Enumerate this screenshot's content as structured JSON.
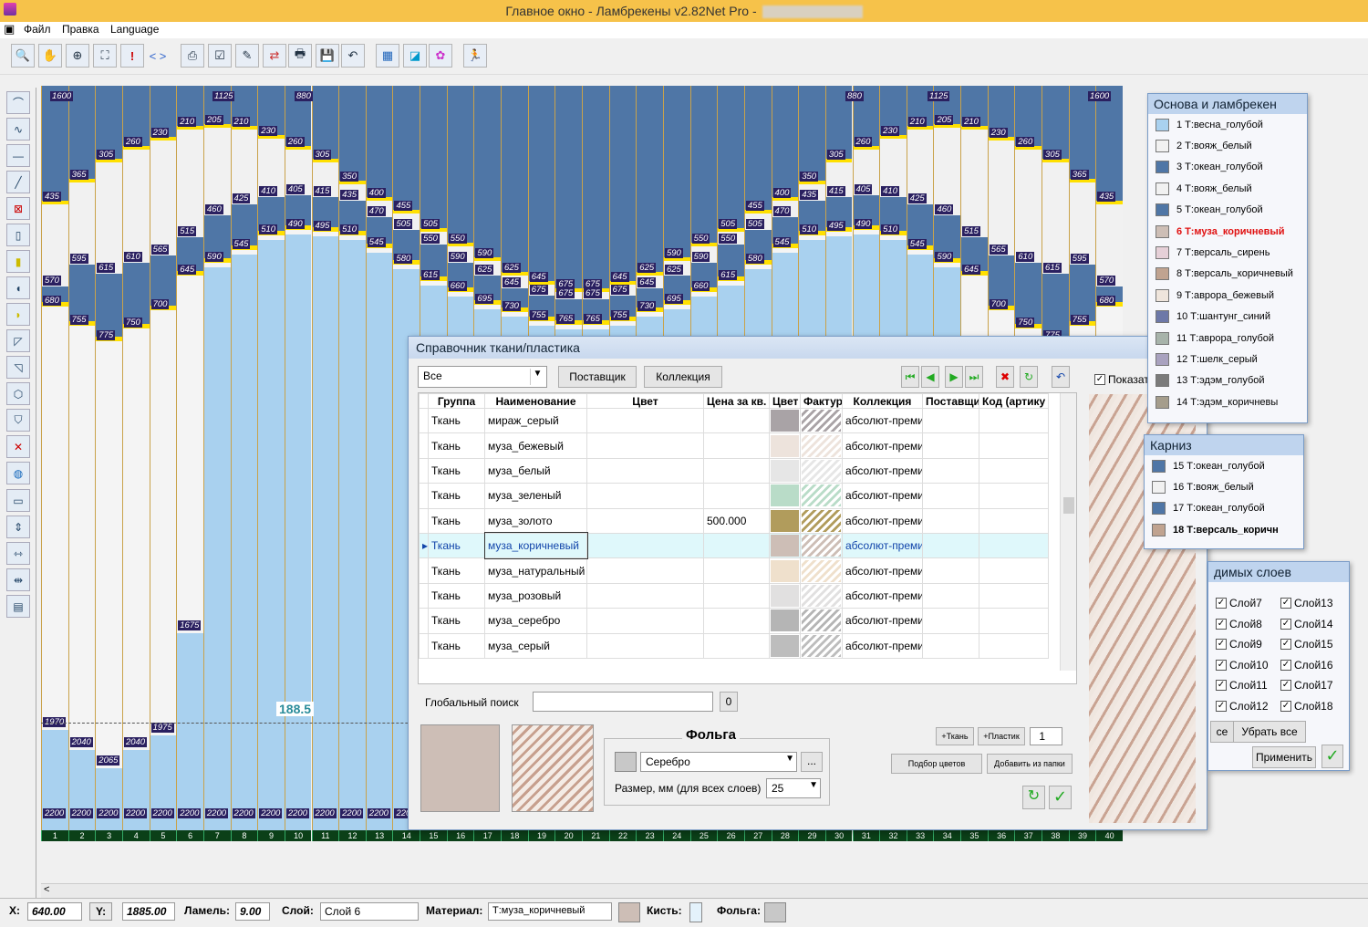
{
  "window": {
    "title": "Главное окно - Ламбрекены v2.82Net Pro  -"
  },
  "menu": [
    "Файл",
    "Правка",
    "Language"
  ],
  "canvas": {
    "top_labels": [
      "1600",
      "1125",
      "880",
      "880",
      "1125",
      "1600"
    ],
    "measure_label": "188.5",
    "bottom_value": "2200",
    "slat_numbers": [
      "1",
      "2",
      "3",
      "4",
      "5",
      "6",
      "7",
      "8",
      "9",
      "10",
      "11",
      "12",
      "13",
      "14",
      "15",
      "16",
      "17",
      "18",
      "19",
      "20",
      "21",
      "22",
      "23",
      "24",
      "25",
      "26",
      "27",
      "28",
      "29",
      "30",
      "31",
      "32",
      "33",
      "34",
      "35",
      "36",
      "37",
      "38",
      "39",
      "40"
    ],
    "slat_labels": [
      [
        "435",
        "570",
        "680",
        "1970"
      ],
      [
        "365",
        "595",
        "755",
        "2040"
      ],
      [
        "305",
        "615",
        "775",
        "2065"
      ],
      [
        "260",
        "610",
        "750",
        "2040"
      ],
      [
        "230",
        "565",
        "700",
        "1975"
      ],
      [
        "210",
        "515",
        "645",
        "1675"
      ],
      [
        "205",
        "460",
        "590"
      ],
      [
        "210",
        "425",
        "545"
      ],
      [
        "230",
        "410",
        "510"
      ],
      [
        "260",
        "405",
        "490"
      ],
      [
        "305",
        "415",
        "495"
      ],
      [
        "350",
        "435",
        "510"
      ],
      [
        "400",
        "470",
        "545"
      ],
      [
        "455",
        "505",
        "580"
      ],
      [
        "505",
        "550",
        "615"
      ],
      [
        "550",
        "590",
        "660"
      ],
      [
        "590",
        "625",
        "695"
      ],
      [
        "625",
        "645",
        "730"
      ],
      [
        "645",
        "675",
        "755"
      ],
      [
        "675",
        "675",
        "765"
      ]
    ]
  },
  "dialog": {
    "title": "Справочник ткани/пластика",
    "filter_value": "Все",
    "supplier_button": "Поставщик",
    "collection_button": "Коллекция",
    "show_label": "Показат",
    "columns": [
      "Группа",
      "Наименование",
      "Цвет",
      "Цена за кв.",
      "Цвет",
      "Фактура",
      "Коллекция",
      "Поставщик",
      "Код (артику"
    ],
    "rows": [
      {
        "group": "Ткань",
        "name": "мираж_серый",
        "price": "",
        "swatch": "#a9a3a6",
        "collection": "абсолют-преми"
      },
      {
        "group": "Ткань",
        "name": "муза_бежевый",
        "price": "",
        "swatch": "#ede3dc",
        "collection": "абсолют-преми"
      },
      {
        "group": "Ткань",
        "name": "муза_белый",
        "price": "",
        "swatch": "#e6e6e6",
        "collection": "абсолют-преми"
      },
      {
        "group": "Ткань",
        "name": "муза_зеленый",
        "price": "",
        "swatch": "#b9dcc8",
        "collection": "абсолют-преми"
      },
      {
        "group": "Ткань",
        "name": "муза_золото",
        "price": "500.000",
        "swatch": "#b19c5c",
        "collection": "абсолют-преми"
      },
      {
        "group": "Ткань",
        "name": "муза_коричневый",
        "price": "",
        "swatch": "#cdbeb6",
        "collection": "абсолют-преми"
      },
      {
        "group": "Ткань",
        "name": "муза_натуральный",
        "price": "",
        "swatch": "#efe0cc",
        "collection": "абсолют-преми"
      },
      {
        "group": "Ткань",
        "name": "муза_розовый",
        "price": "",
        "swatch": "#e1e0e0",
        "collection": "абсолют-преми"
      },
      {
        "group": "Ткань",
        "name": "муза_серебро",
        "price": "",
        "swatch": "#b5b5b5",
        "collection": "абсолют-преми"
      },
      {
        "group": "Ткань",
        "name": "муза_серый",
        "price": "",
        "swatch": "#bdbdbd",
        "collection": "абсолют-преми"
      }
    ],
    "selected_row": 5,
    "global_search_label": "Глобальный поиск",
    "global_search_count": "0",
    "foil_title": "Фольга",
    "foil_value": "Серебро",
    "size_label": "Размер, мм (для всех слоев)",
    "size_value": "25",
    "add_fabric": "+Ткань",
    "add_plastic": "+Пластик",
    "qty": "1",
    "pick_colors": "Подбор цветов",
    "add_from_folder": "Добавить из папки"
  },
  "layers_panel": {
    "title": "Основа и ламбрекен",
    "items": [
      {
        "label": "1 Т:весна_голубой",
        "color": "#a9d1ef"
      },
      {
        "label": "2 Т:вояж_белый",
        "color": "#f1f1f1"
      },
      {
        "label": "3 Т:океан_голубой",
        "color": "#4f76a6"
      },
      {
        "label": "4 Т:вояж_белый",
        "color": "#f1f1f1"
      },
      {
        "label": "5 Т:океан_голубой",
        "color": "#4f76a6"
      },
      {
        "label": "6 Т:муза_коричневый",
        "color": "#cdbeb6",
        "active": true
      },
      {
        "label": "7 Т:версаль_сирень",
        "color": "#e6d0d8"
      },
      {
        "label": "8 Т:версаль_коричневый",
        "color": "#c0a390"
      },
      {
        "label": "9 Т:аврора_бежевый",
        "color": "#efe5dc"
      },
      {
        "label": "10 Т:шантунг_синий",
        "color": "#6d78a8"
      },
      {
        "label": "11 Т:аврора_голубой",
        "color": "#a7b3aa"
      },
      {
        "label": "12 Т:шелк_серый",
        "color": "#a9a2bf"
      },
      {
        "label": "13 Т:эдэм_голубой",
        "color": "#7b7b7b"
      },
      {
        "label": "14 Т:эдэм_коричневы",
        "color": "#a59d8c"
      }
    ]
  },
  "cornice_panel": {
    "title": "Карниз",
    "items": [
      {
        "label": "15 Т:океан_голубой",
        "color": "#4f76a6"
      },
      {
        "label": "16 Т:вояж_белый",
        "color": "#f1f1f1"
      },
      {
        "label": "17 Т:океан_голубой",
        "color": "#4f76a6"
      },
      {
        "label": "18 Т:версаль_коричн",
        "color": "#c0a390",
        "bold": true
      }
    ]
  },
  "visible_layers": {
    "title": "димых слоев",
    "col1": [
      "Слой7",
      "Слой8",
      "Слой9",
      "Слой10",
      "Слой11",
      "Слой12"
    ],
    "col2": [
      "Слой13",
      "Слой14",
      "Слой15",
      "Слой16",
      "Слой17",
      "Слой18"
    ],
    "partial_button": "се",
    "remove_all": "Убрать все",
    "apply": "Применить"
  },
  "status": {
    "x_label": "X:",
    "x_value": "640.00",
    "y_label": "Y:",
    "y_value": "1885.00",
    "lamel_label": "Ламель:",
    "lamel_value": "9.00",
    "layer_label": "Слой:",
    "layer_value": "Слой 6",
    "material_label": "Материал:",
    "material_value": "Т:муза_коричневый",
    "material_color": "#cdbeb6",
    "brush_label": "Кисть:",
    "foil_label": "Фольга:",
    "foil_color": "#c8c8c8"
  }
}
